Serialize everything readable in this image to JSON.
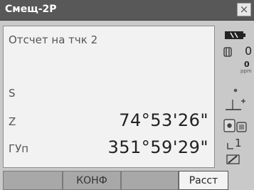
{
  "window": {
    "title": "Смещ-2Р",
    "close_glyph": "×"
  },
  "main": {
    "rows": [
      {
        "label": "Отсчет на тчк 2",
        "value": ""
      },
      {
        "label": "S",
        "value": ""
      },
      {
        "label": "Z",
        "value": "74°53'26\""
      },
      {
        "label": "ГУп",
        "value": "351°59'29\""
      }
    ]
  },
  "sidebar": {
    "battery_icon": "battery-icon",
    "prism_constant": "0",
    "ppm_value": "0",
    "ppm_unit": "ppm",
    "target_type_icon": "target-icon",
    "reflector_icon": "reflector-icon",
    "page_number": "1",
    "edit_icon": "pen-icon"
  },
  "softkeys": [
    {
      "label": "",
      "active": false
    },
    {
      "label": "КОНФ",
      "active": false
    },
    {
      "label": "",
      "active": false
    },
    {
      "label": "Расст",
      "active": true
    }
  ]
}
